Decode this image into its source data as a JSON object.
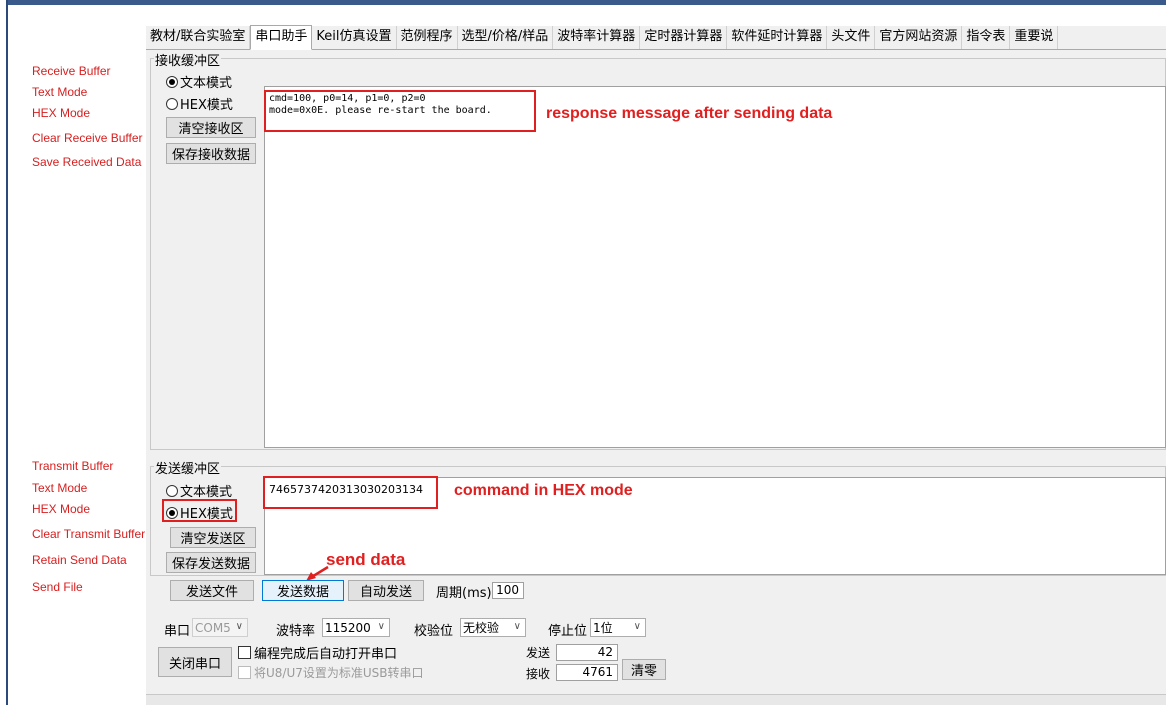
{
  "tabs": [
    "教材/联合实验室",
    "串口助手",
    "Keil仿真设置",
    "范例程序",
    "选型/价格/样品",
    "波特率计算器",
    "定时器计算器",
    "软件延时计算器",
    "头文件",
    "官方网站资源",
    "指令表",
    "重要说"
  ],
  "active_tab": "串口助手",
  "annotations": {
    "receive_buffer": "Receive Buffer",
    "rx_text_mode": "Text Mode",
    "rx_hex_mode": "HEX Mode",
    "clear_receive_buffer": "Clear Receive Buffer",
    "save_received_data": "Save Received Data",
    "transmit_buffer": "Transmit Buffer",
    "tx_text_mode": "Text Mode",
    "tx_hex_mode": "HEX Mode",
    "clear_transmit_buffer": "Clear Transmit Buffer",
    "retain_send_data": "Retain Send Data",
    "send_file": "Send File",
    "response_note": "response message after sending data",
    "command_note": "command in HEX mode",
    "send_note": "send data"
  },
  "receive": {
    "group_title": "接收缓冲区",
    "text_mode": "文本模式",
    "hex_mode": "HEX模式",
    "selected_mode": "text",
    "clear_button": "清空接收区",
    "save_button": "保存接收数据",
    "content_line1": "cmd=100, p0=14, p1=0, p2=0",
    "content_line2": "mode=0x0E. please re-start the board."
  },
  "transmit": {
    "group_title": "发送缓冲区",
    "text_mode": "文本模式",
    "hex_mode": "HEX模式",
    "selected_mode": "hex",
    "clear_button": "清空发送区",
    "retain_button": "保存发送数据",
    "content": "7465737420313030203134",
    "send_file_button": "发送文件",
    "send_data_button": "发送数据",
    "auto_send_button": "自动发送",
    "period_label": "周期(ms)",
    "period_value": "100"
  },
  "serial": {
    "port_label": "串口",
    "port_value": "COM5",
    "baud_label": "波特率",
    "baud_value": "115200",
    "parity_label": "校验位",
    "parity_value": "无校验",
    "stop_label": "停止位",
    "stop_value": "1位",
    "close_button": "关闭串口",
    "auto_open_label": "编程完成后自动打开串口",
    "usb_label": "将U8/U7设置为标准USB转串口",
    "send_count_label": "发送",
    "send_count": "42",
    "recv_count_label": "接收",
    "recv_count": "4761",
    "clear_counts_button": "清零"
  },
  "colors": {
    "annotation": "#d62020",
    "highlight_box": "#e02020",
    "title_bar": "#3a5a8c"
  }
}
